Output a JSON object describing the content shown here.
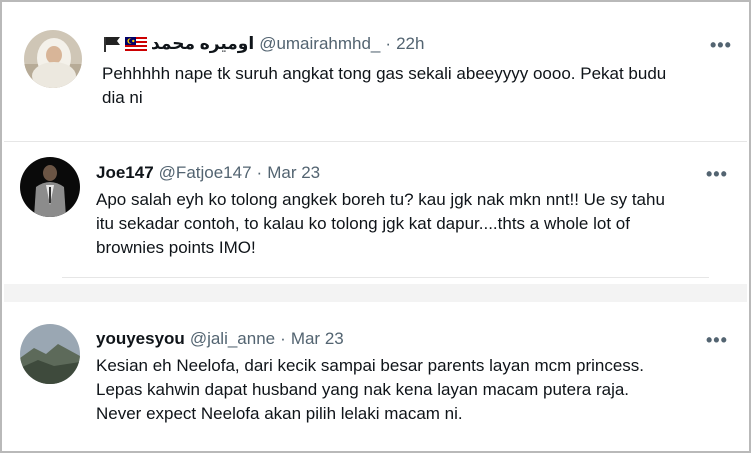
{
  "tweets": [
    {
      "name": "اوميره محمد",
      "handle": "@umairahmhd_",
      "separator": "·",
      "time": "22h",
      "text_lines": [
        "Pehhhhh nape tk suruh angkat tong gas sekali abeeyyyy oooo. Pekat budu",
        "dia ni"
      ],
      "more_label": "•••",
      "flag_icons": [
        "black-flag-icon",
        "malaysia-flag-icon"
      ]
    },
    {
      "name": "Joe147",
      "handle": "@Fatjoe147",
      "separator": "·",
      "time": "Mar 23",
      "text_lines": [
        "Apo salah eyh ko tolong angkek boreh tu? kau jgk nak mkn nnt!! Ue sy tahu",
        "itu sekadar contoh, to kalau ko tolong jgk kat dapur....thts a whole lot of",
        "brownies points IMO!"
      ],
      "more_label": "•••"
    },
    {
      "name": "youyesyou",
      "handle": "@jali_anne",
      "separator": "·",
      "time": "Mar 23",
      "text_lines": [
        "Kesian eh Neelofa, dari kecik sampai besar parents layan mcm princess.",
        "Lepas kahwin dapat husband yang nak kena layan macam putera raja.",
        "Never expect Neelofa akan pilih lelaki macam ni."
      ],
      "more_label": "•••"
    }
  ],
  "colors": {
    "text": "#0f1419",
    "secondary": "#536471",
    "divider": "#e6e6e6",
    "band": "#f3f3f3"
  }
}
